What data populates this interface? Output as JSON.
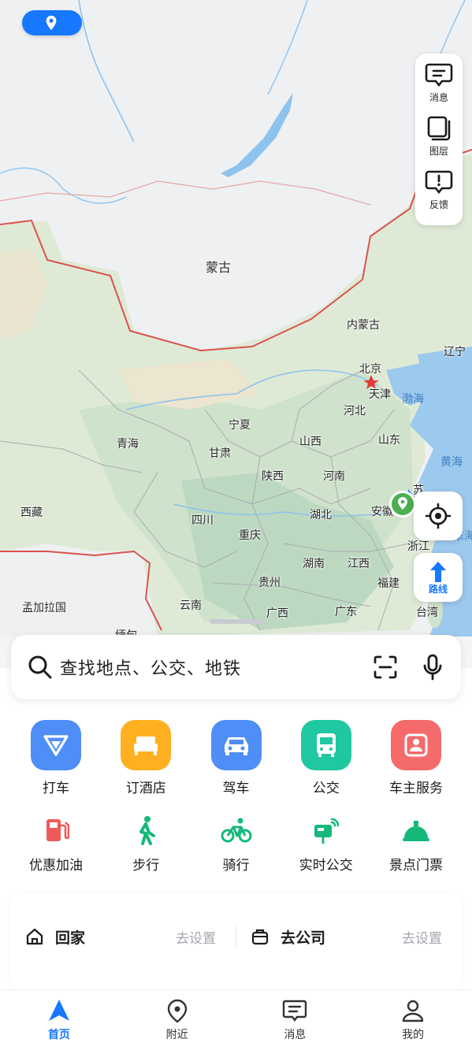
{
  "map": {
    "labels": {
      "mongolia": "蒙古",
      "inner_mongolia": "内蒙古",
      "liaoning": "辽宁",
      "beijing": "北京",
      "tianjin": "天津",
      "bohai": "渤海",
      "hebei": "河北",
      "qinghai": "青海",
      "ningxia": "宁夏",
      "gansu": "甘肃",
      "shanxi": "山西",
      "shandong": "山东",
      "yellow_sea": "黄海",
      "shaanxi": "陕西",
      "henan": "河南",
      "tibet": "西藏",
      "sichuan": "四川",
      "hubei": "湖北",
      "anhui": "安徽",
      "chongqing": "重庆",
      "zhejiang": "浙江",
      "hunan": "湖南",
      "jiangxi": "江西",
      "guizhou": "贵州",
      "fujian": "福建",
      "bangladesh": "孟加拉国",
      "yunnan": "云南",
      "guangxi": "广西",
      "guangdong": "广东",
      "taiwan": "台湾",
      "jiangsu_partial": "苏",
      "east_china_sea_partial": "东海",
      "myanmar_partial": "缅甸"
    },
    "side_panel": {
      "messages": "消息",
      "layers": "图层",
      "feedback": "反馈"
    },
    "route_label": "路线"
  },
  "search": {
    "placeholder": "查找地点、公交、地铁"
  },
  "shortcuts": [
    {
      "label": "打车",
      "color": "#4f8ef7",
      "icon": "taxi-icon"
    },
    {
      "label": "订酒店",
      "color": "#ffb020",
      "icon": "hotel-bed-icon"
    },
    {
      "label": "驾车",
      "color": "#4f8ef7",
      "icon": "car-icon"
    },
    {
      "label": "公交",
      "color": "#1fc8a0",
      "icon": "bus-icon"
    },
    {
      "label": "车主服务",
      "color": "#f56b6b",
      "icon": "car-owner-icon"
    }
  ],
  "shortcuts2": [
    {
      "label": "优惠加油",
      "color": "#f05a5a",
      "icon": "fuel-icon"
    },
    {
      "label": "步行",
      "color": "#14b97a",
      "icon": "walk-icon"
    },
    {
      "label": "骑行",
      "color": "#14b97a",
      "icon": "bike-icon"
    },
    {
      "label": "实时公交",
      "color": "#14b97a",
      "icon": "realtime-bus-icon"
    },
    {
      "label": "景点门票",
      "color": "#14b97a",
      "icon": "scenic-ticket-icon"
    }
  ],
  "home_company": {
    "home": {
      "label": "回家",
      "action": "去设置"
    },
    "company": {
      "label": "去公司",
      "action": "去设置"
    }
  },
  "tabs": [
    {
      "label": "首页",
      "active": true
    },
    {
      "label": "附近",
      "active": false
    },
    {
      "label": "消息",
      "active": false
    },
    {
      "label": "我的",
      "active": false
    }
  ],
  "colors": {
    "accent": "#1677ff",
    "border_red": "#d9534f",
    "sea": "#9cc9ee"
  }
}
